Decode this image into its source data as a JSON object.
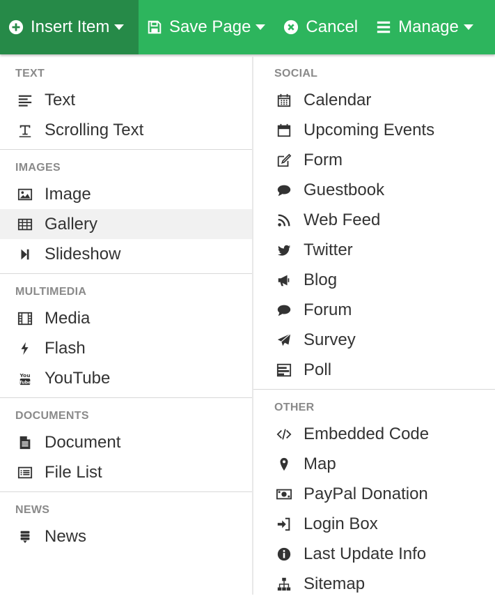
{
  "toolbar": {
    "insert_label": "Insert Item",
    "save_label": "Save Page",
    "cancel_label": "Cancel",
    "manage_label": "Manage"
  },
  "left": {
    "text": {
      "heading": "TEXT",
      "items": [
        {
          "label": "Text",
          "icon": "align-left-icon"
        },
        {
          "label": "Scrolling Text",
          "icon": "text-cursor-icon"
        }
      ]
    },
    "images": {
      "heading": "IMAGES",
      "items": [
        {
          "label": "Image",
          "icon": "picture-icon"
        },
        {
          "label": "Gallery",
          "icon": "table-icon"
        },
        {
          "label": "Slideshow",
          "icon": "step-forward-icon"
        }
      ]
    },
    "multimedia": {
      "heading": "MULTIMEDIA",
      "items": [
        {
          "label": "Media",
          "icon": "film-icon"
        },
        {
          "label": "Flash",
          "icon": "bolt-icon"
        },
        {
          "label": "YouTube",
          "icon": "youtube-icon"
        }
      ]
    },
    "documents": {
      "heading": "DOCUMENTS",
      "items": [
        {
          "label": "Document",
          "icon": "file-text-icon"
        },
        {
          "label": "File List",
          "icon": "list-alt-icon"
        }
      ]
    },
    "news": {
      "heading": "NEWS",
      "items": [
        {
          "label": "News",
          "icon": "news-icon"
        }
      ]
    }
  },
  "right": {
    "social": {
      "heading": "SOCIAL",
      "items": [
        {
          "label": "Calendar",
          "icon": "calendar-icon"
        },
        {
          "label": "Upcoming Events",
          "icon": "calendar-empty-icon"
        },
        {
          "label": "Form",
          "icon": "edit-icon"
        },
        {
          "label": "Guestbook",
          "icon": "comment-icon"
        },
        {
          "label": "Web Feed",
          "icon": "rss-icon"
        },
        {
          "label": "Twitter",
          "icon": "twitter-icon"
        },
        {
          "label": "Blog",
          "icon": "bullhorn-icon"
        },
        {
          "label": "Forum",
          "icon": "comment-icon"
        },
        {
          "label": "Survey",
          "icon": "paper-plane-icon"
        },
        {
          "label": "Poll",
          "icon": "poll-icon"
        }
      ]
    },
    "other": {
      "heading": "OTHER",
      "items": [
        {
          "label": "Embedded Code",
          "icon": "code-icon"
        },
        {
          "label": "Map",
          "icon": "map-marker-icon"
        },
        {
          "label": "PayPal Donation",
          "icon": "money-icon"
        },
        {
          "label": "Login Box",
          "icon": "sign-in-icon"
        },
        {
          "label": "Last Update Info",
          "icon": "info-circle-icon"
        },
        {
          "label": "Sitemap",
          "icon": "sitemap-icon"
        }
      ]
    }
  },
  "colors": {
    "toolbar": "#2db55d",
    "toolbar_active": "#268a48",
    "heading": "#8a8a8a",
    "hover": "#f1f1f1"
  }
}
